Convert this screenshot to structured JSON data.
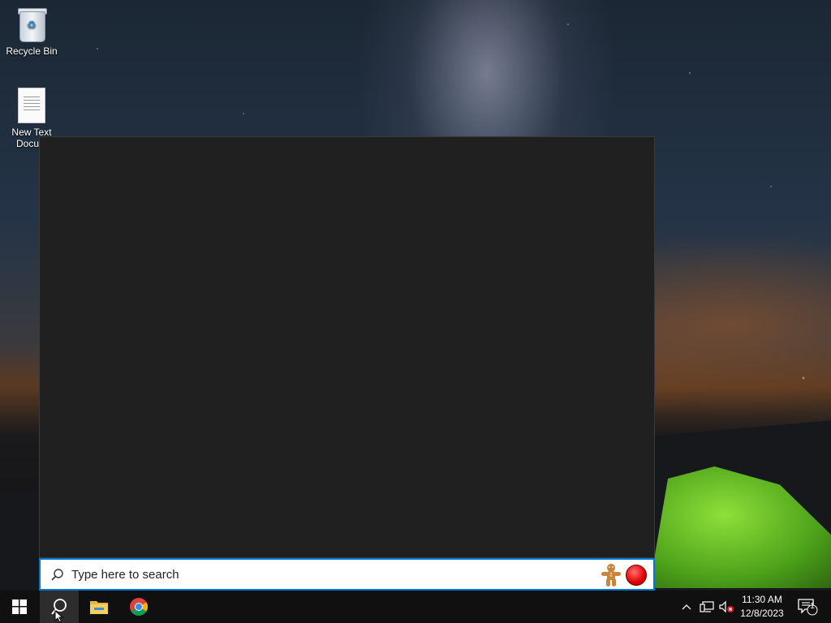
{
  "desktop": {
    "icons": [
      {
        "label": "Recycle Bin"
      },
      {
        "label": "New Text Docum"
      }
    ]
  },
  "search": {
    "placeholder": "Type here to search",
    "focus_color": "#0078d7"
  },
  "taskbar": {
    "apps": [
      {
        "name": "start-icon"
      },
      {
        "name": "search-icon"
      },
      {
        "name": "file-explorer-icon"
      },
      {
        "name": "chrome-icon"
      }
    ],
    "clock": {
      "time": "11:30 AM",
      "date": "12/8/2023"
    },
    "notifications_count": "1"
  }
}
